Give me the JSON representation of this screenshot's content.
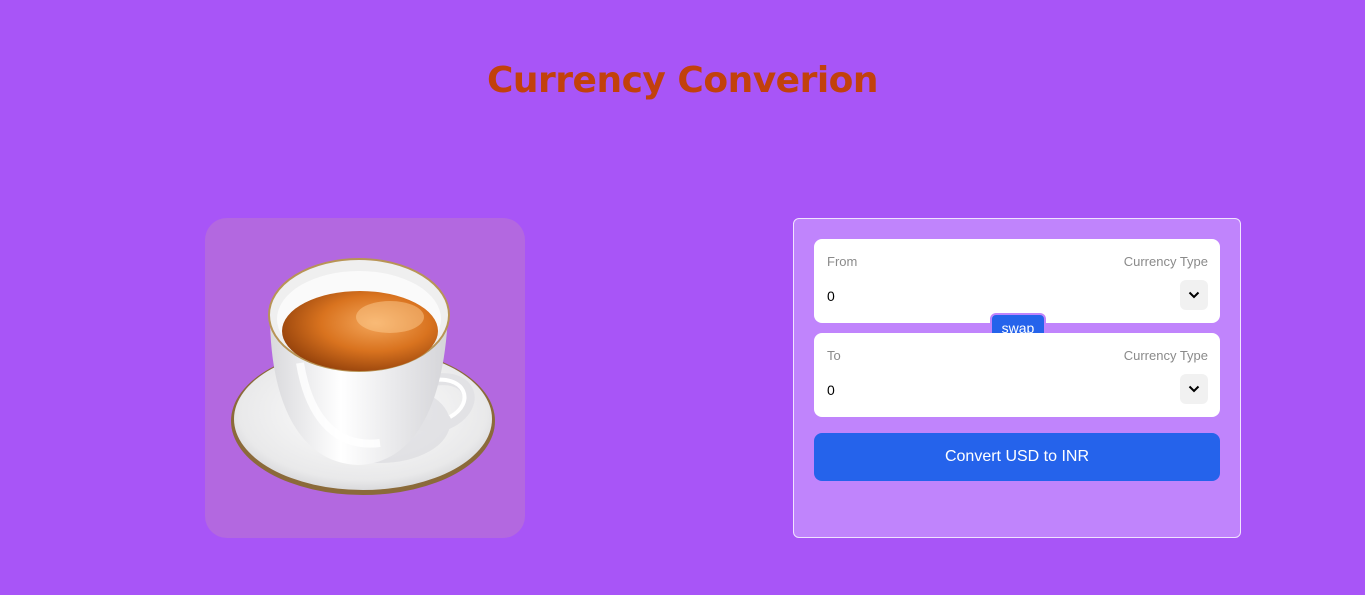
{
  "header": {
    "title": "Currency Converion"
  },
  "hero_image": {
    "icon": "teacup-image"
  },
  "converter": {
    "from": {
      "label": "From",
      "type_label": "Currency Type",
      "value": "0"
    },
    "to": {
      "label": "To",
      "type_label": "Currency Type",
      "value": "0"
    },
    "swap_label": "swap",
    "convert_label": "Convert USD to INR"
  },
  "colors": {
    "background": "#a855f7",
    "title": "#c2410c",
    "button": "#2563eb",
    "panel": "#c084fc"
  }
}
